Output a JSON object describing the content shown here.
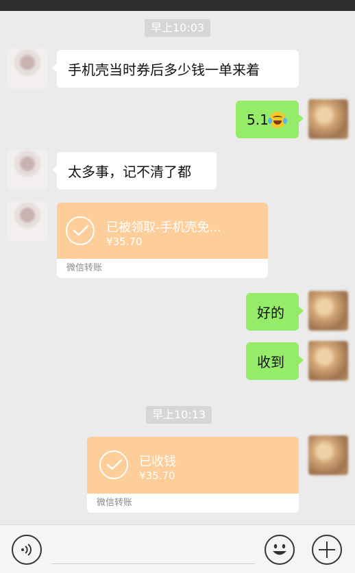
{
  "timestamps": [
    "早上10:03",
    "早上10:13"
  ],
  "messages": {
    "m1": "手机壳当时券后多少钱一单来着",
    "m2": "5.1",
    "m3": "太多事，记不清了都",
    "m4": "好的",
    "m5": "收到"
  },
  "transfers": {
    "t1": {
      "title": "已被领取-手机壳免...",
      "amount": "¥35.70",
      "footer": "微信转账"
    },
    "t2": {
      "title": "已收钱",
      "amount": "¥35.70",
      "footer": "微信转账"
    }
  },
  "icons": {
    "voice": "voice-icon",
    "emoji": "emoji-icon",
    "more": "plus-icon",
    "sticker": "crying-laughing-emoji"
  },
  "colors": {
    "background": "#ebebeb",
    "green_bubble": "#95ec69",
    "transfer_orange": "#fdce99",
    "time_pill": "#d6d6d6"
  }
}
